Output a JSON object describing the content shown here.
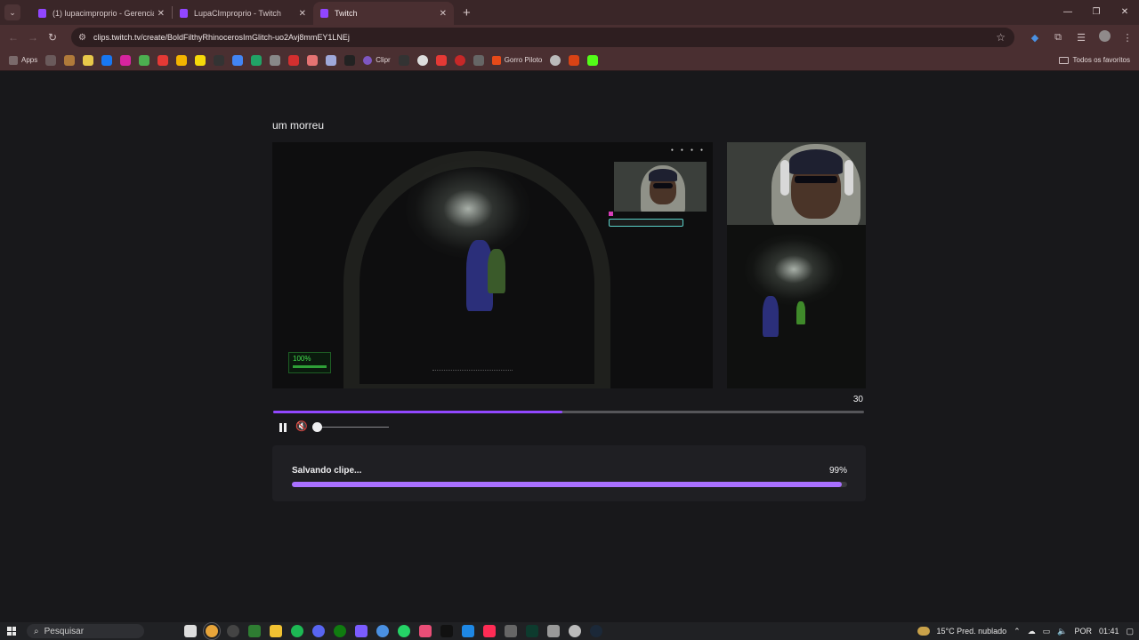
{
  "browser": {
    "tabs": [
      {
        "title": "(1) lupacimproprio - Gerenciador",
        "active": false
      },
      {
        "title": "LupaCImproprio - Twitch",
        "active": false
      },
      {
        "title": "Twitch",
        "active": true
      }
    ],
    "new_tab": "+",
    "window_controls": [
      "—",
      "❐",
      "✕"
    ],
    "url": "clips.twitch.tv/create/BoldFilthyRhinocerosImGlitch-uo2Avj8mmEY1LNEj",
    "bookmarks": {
      "apps_label": "Apps",
      "items": [
        "Clipr",
        "Gorro Piloto"
      ],
      "all_bookmarks": "Todos os favoritos"
    }
  },
  "clip": {
    "title": "um morreu",
    "hud_health": "100%",
    "duration": "30",
    "seek_progress": 0.49
  },
  "saving": {
    "label": "Salvando clipe...",
    "percent_text": "99%",
    "progress": 0.99
  },
  "taskbar": {
    "search_placeholder": "Pesquisar",
    "weather": "15°C  Pred. nublado",
    "language": "POR",
    "time": "01:41"
  },
  "colors": {
    "accent": "#9147ff",
    "progress": "#a970ff",
    "chrome": "#4a2f31"
  }
}
